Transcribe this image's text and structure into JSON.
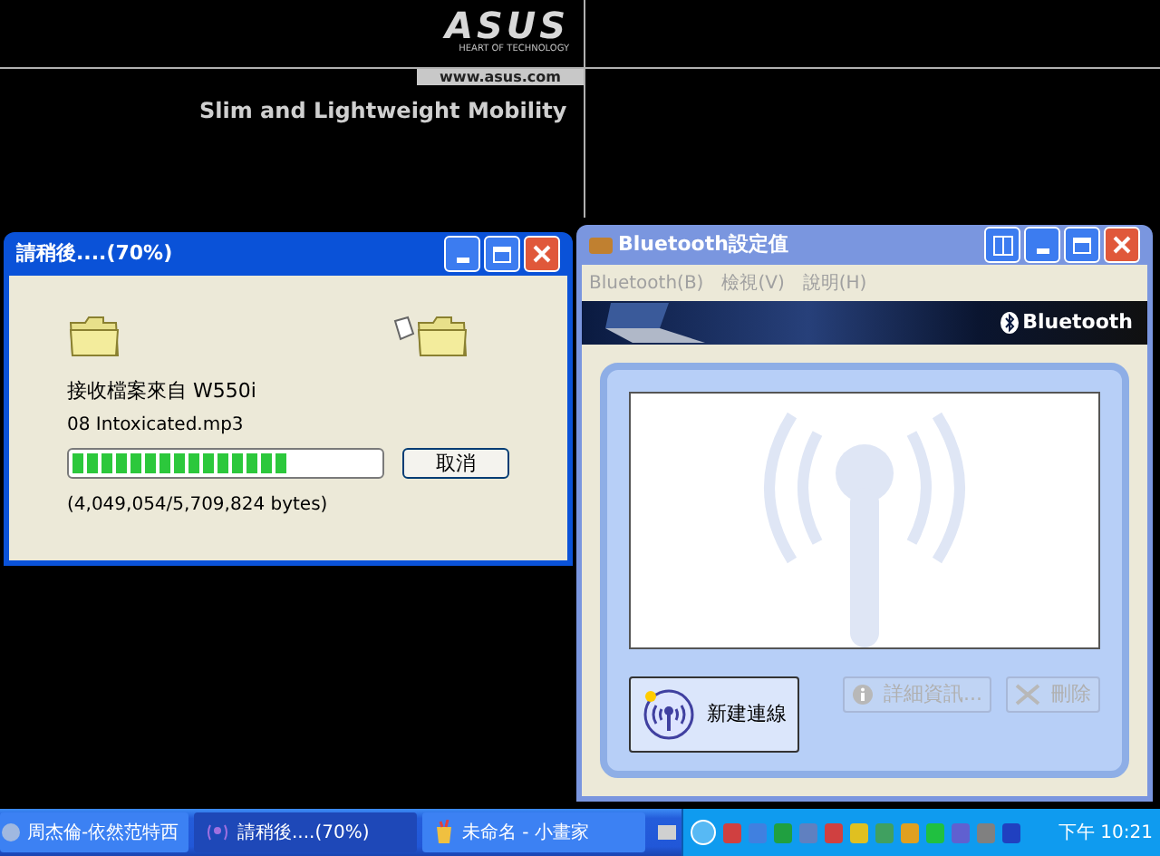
{
  "desktop": {
    "logo": "ASUS",
    "logo_tagline": "HEART OF TECHNOLOGY",
    "url": "www.asus.com",
    "slogan": "Slim and Lightweight Mobility"
  },
  "progress_window": {
    "title": "請稍後....(70%)",
    "message": "接收檔案來自 W550i",
    "filename": "08 Intoxicated.mp3",
    "progress": {
      "level": 0.7
    },
    "cancel_button": "取消",
    "bytes": "(4,049,054/5,709,824 bytes)"
  },
  "bluetooth_window": {
    "title": "Bluetooth設定值",
    "menu": [
      {
        "label": "Bluetooth(B)"
      },
      {
        "label": "檢視(V)"
      },
      {
        "label": "說明(H)"
      }
    ],
    "banner_logo": "Bluetooth",
    "buttons": [
      {
        "label": "新建連線",
        "kind": "new",
        "disabled": false
      },
      {
        "label": "詳細資訊...",
        "kind": "info",
        "disabled": true
      },
      {
        "label": "刪除",
        "kind": "delete",
        "disabled": true
      }
    ]
  },
  "taskbar": {
    "tasks": [
      {
        "label": "周杰倫-依然范特西",
        "kind": "music",
        "selected": false
      },
      {
        "label": "請稍後....(70%)",
        "kind": "bluetooth",
        "selected": true
      },
      {
        "label": "未命名 - 小畫家",
        "kind": "paint",
        "selected": false
      }
    ],
    "clock": "下午 10:21"
  }
}
